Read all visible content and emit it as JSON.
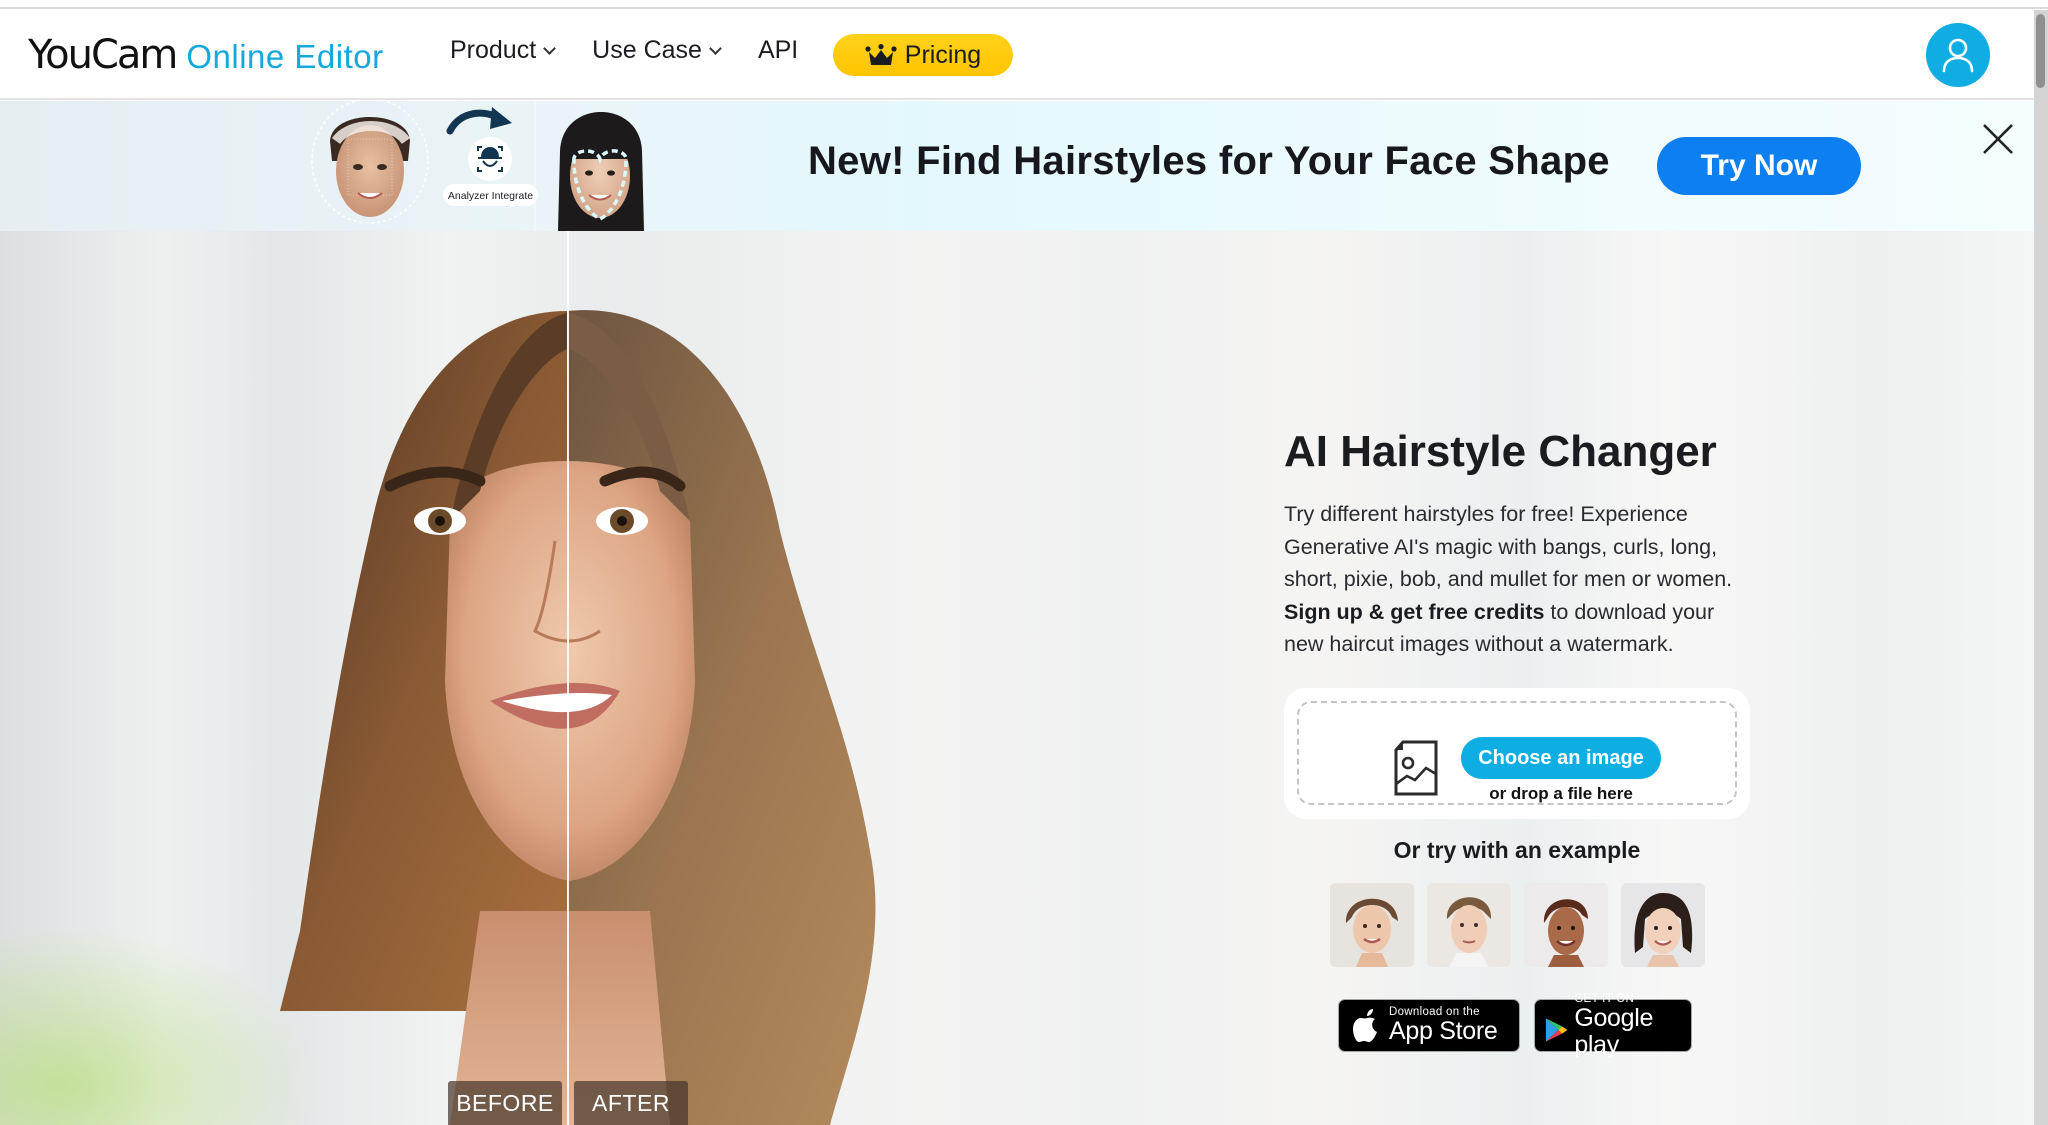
{
  "header": {
    "logo_brand": "YouCam",
    "logo_product": "Online Editor",
    "nav": [
      {
        "label": "Product",
        "has_dropdown": true
      },
      {
        "label": "Use Case",
        "has_dropdown": true
      },
      {
        "label": "API",
        "has_dropdown": false
      }
    ],
    "pricing_label": "Pricing",
    "account_icon": "user-icon"
  },
  "promo": {
    "badge_text": "Analyzer Integrate",
    "title": "New! Find Hairstyles for Your Face Shape",
    "cta_label": "Try Now",
    "close_icon": "close-icon"
  },
  "hero": {
    "before_label": "BEFORE",
    "after_label": "AFTER",
    "title": "AI Hairstyle Changer",
    "description_lines": [
      "Try different hairstyles for free! Experience Generative AI's magic with bangs, curls, long, short, pixie, bob, and mullet for men or women."
    ],
    "description_bold": "Sign up & get free credits",
    "description_tail": " to download your new haircut images without a watermark.",
    "upload": {
      "button_label": "Choose an image",
      "drop_text": "or drop a file here",
      "icon": "image-file-icon"
    },
    "examples_title": "Or try with an example",
    "examples": [
      {
        "name": "example-woman-curly-updo"
      },
      {
        "name": "example-man-tousled"
      },
      {
        "name": "example-woman-short-red"
      },
      {
        "name": "example-woman-bob"
      }
    ],
    "app_store": {
      "small": "Download on the",
      "big": "App Store"
    },
    "google_play": {
      "small": "GET IT ON",
      "big": "Google play"
    }
  },
  "colors": {
    "brand_blue": "#14a8dc",
    "pricing_yellow": "#ffc400",
    "cta_blue": "#0d7ff0",
    "upload_button": "#0eaee3",
    "avatar_bg": "#10ade2"
  }
}
